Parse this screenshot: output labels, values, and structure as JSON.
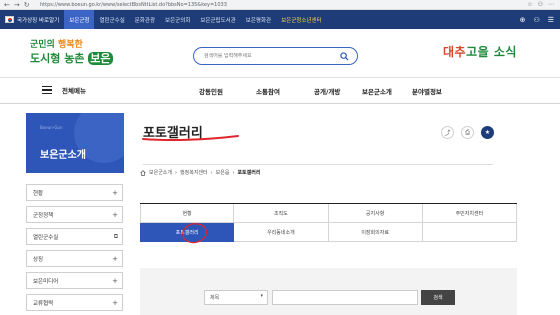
{
  "browser": {
    "back": "←",
    "forward": "→",
    "reload": "↻",
    "url": "https://www.boeun.go.kr/www/selectBbsNttList.do?bbsNo=135&key=1033",
    "tools": [
      "☆",
      "⚇",
      "⋯"
    ]
  },
  "gov_bar": {
    "items": [
      {
        "label": "국가상징 바로알기",
        "active": false
      },
      {
        "label": "보은군청",
        "active": true
      },
      {
        "label": "열린군수실",
        "active": false
      },
      {
        "label": "문화관광",
        "active": false
      },
      {
        "label": "보은군의회",
        "active": false
      },
      {
        "label": "보은군립도서관",
        "active": false
      },
      {
        "label": "보은평화관",
        "active": false
      },
      {
        "label": "보은군청소년센터",
        "active": false,
        "highlight": true
      }
    ],
    "colors": {
      "bar": "#1d3c78",
      "active": "#3b64c4",
      "highlight": "#ffd84a"
    }
  },
  "header": {
    "logo": {
      "line1_a": "군민의 ",
      "line1_b": "행복한",
      "line2_a": "도시형 농촌 ",
      "line2_b": "보은"
    },
    "search_placeholder": "검색어를 입력해주세요",
    "slogan_a": "대추",
    "slogan_b": "고을 소식"
  },
  "gnb": {
    "all_menu": "전체메뉴",
    "items": [
      "강동민원",
      "소통참여",
      "공개/개방",
      "보은군소개",
      "분야별정보"
    ]
  },
  "side": {
    "banner_en": "Boeun-Gun",
    "banner_title": "보은군소개",
    "items": [
      {
        "label": "현황",
        "mark": "+"
      },
      {
        "label": "군정정책",
        "mark": "+"
      },
      {
        "label": "열린군수실",
        "mark": "⧉"
      },
      {
        "label": "상징",
        "mark": "+"
      },
      {
        "label": "보은미디어",
        "mark": "+"
      },
      {
        "label": "교류협력",
        "mark": "+"
      }
    ]
  },
  "page": {
    "title": "포토갤러리",
    "breadcrumb": [
      "보은군소개",
      "행정복지센터",
      "보은읍",
      "포토갤러리"
    ],
    "breadcrumb_sep": "›",
    "tools": {
      "share": "⤴",
      "print": "⎙",
      "favorite": "★"
    }
  },
  "tabs": {
    "row1": [
      "현황",
      "조직도",
      "공지사항",
      "주민자치센터"
    ],
    "row2": [
      "포토갤러리",
      "우리동네소개",
      "이장회의자료",
      ""
    ],
    "active": "포토갤러리"
  },
  "search": {
    "select_value": "제목",
    "select_arrow": "▾",
    "button": "검색"
  }
}
